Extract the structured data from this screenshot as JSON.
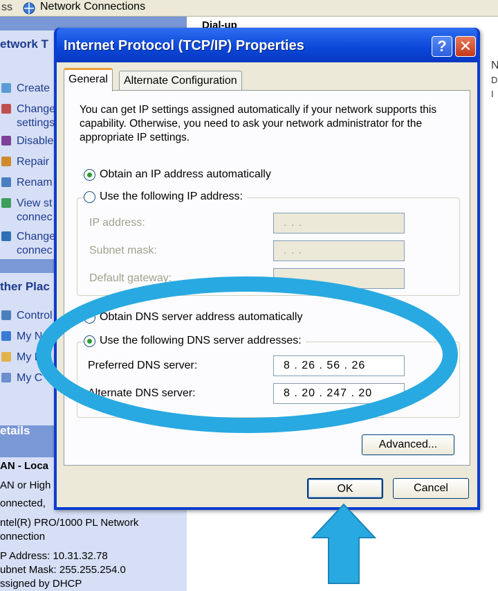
{
  "background": {
    "crumb": "ss",
    "window_title": "Network Connections",
    "section_right": "Dial-up",
    "right_edge_text": [
      "N",
      "D",
      "I"
    ],
    "network_tasks": {
      "header": "etwork T",
      "items": [
        "Create",
        "Change",
        "settings",
        "Disable",
        "Repair",
        "Renam",
        "View st",
        "connec",
        "Change",
        "connec"
      ]
    },
    "other_places": {
      "header": "ther Plac",
      "items": [
        "Control",
        "My Net",
        "My D",
        "My C"
      ]
    },
    "details": {
      "header": "etails",
      "lines": [
        "AN - Loca",
        "AN or High",
        "onnected,",
        "ntel(R) PRO/1000 PL Network",
        "onnection",
        "P Address: 10.31.32.78",
        "ubnet Mask: 255.255.254.0",
        "ssigned by DHCP"
      ]
    }
  },
  "dialog": {
    "title": "Internet Protocol (TCP/IP) Properties",
    "help_label": "?",
    "close_label": "✕",
    "tabs": [
      "General",
      "Alternate Configuration"
    ],
    "intro": "You can get IP settings assigned automatically if your network supports this capability. Otherwise, you need to ask your network administrator for the appropriate IP settings.",
    "ip": {
      "auto_label": "Obtain an IP address automatically",
      "manual_label": "Use the following IP address:",
      "ip_label": "IP address:",
      "mask_label": "Subnet mask:",
      "gateway_label": "Default gateway:",
      "empty_value": ".    .    ."
    },
    "dns": {
      "auto_label": "Obtain DNS server address automatically",
      "manual_label": "Use the following DNS server addresses:",
      "preferred_label": "Preferred DNS server:",
      "preferred_value": "8 . 26 . 56 . 26",
      "alternate_label": "Alternate DNS server:",
      "alternate_value": "8 . 20 . 247 . 20"
    },
    "advanced_label": "Advanced...",
    "ok_label": "OK",
    "cancel_label": "Cancel"
  },
  "colors": {
    "xp_title_blue": "#0a46d8",
    "highlight_cyan": "#29a9e1"
  }
}
